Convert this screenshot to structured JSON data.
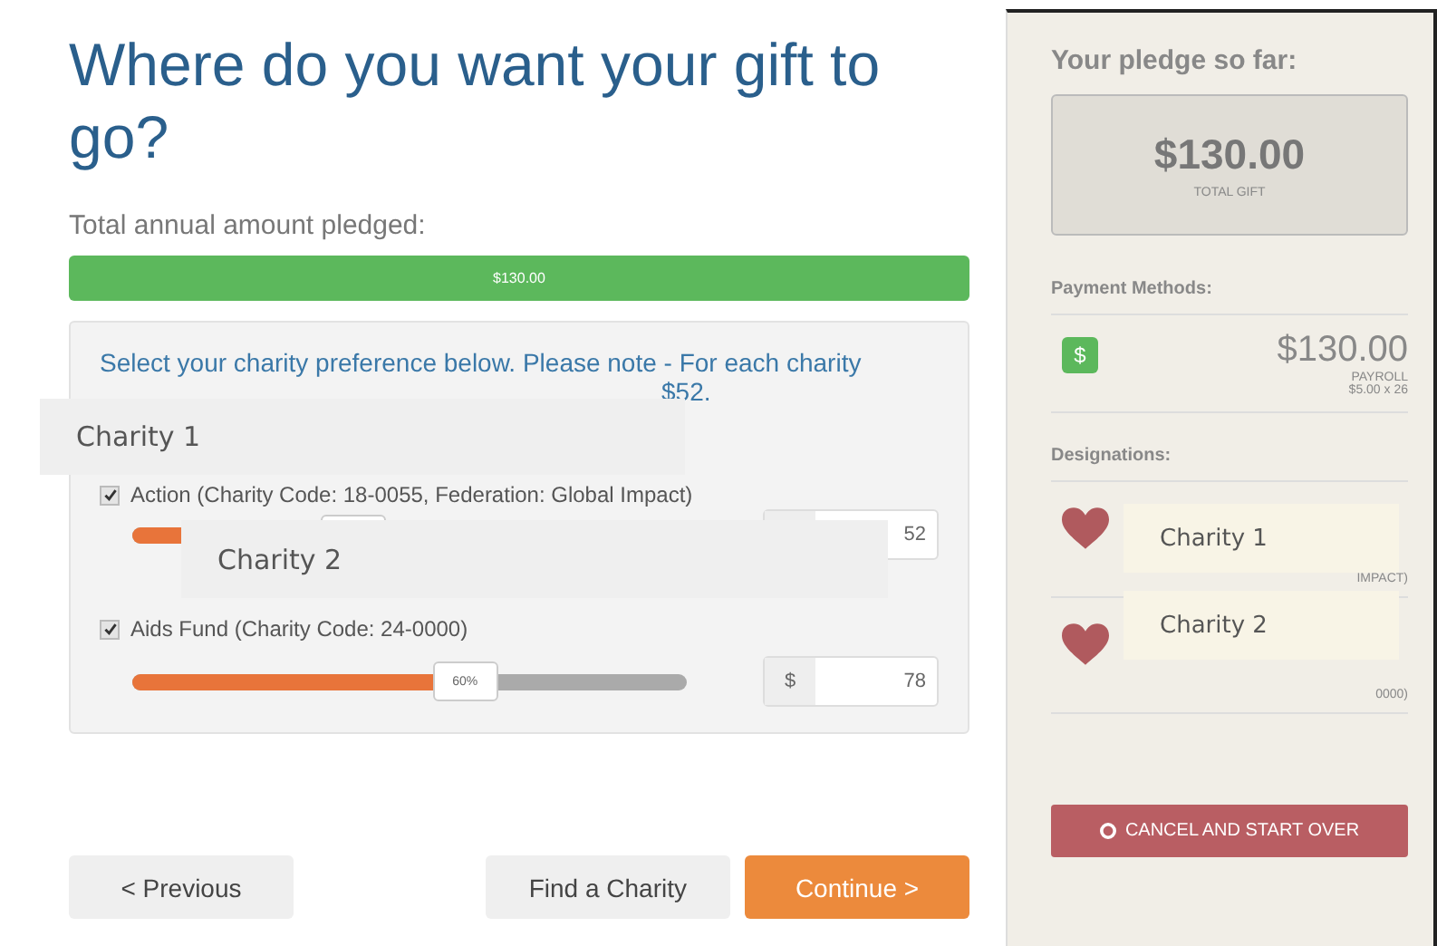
{
  "main": {
    "title": "Where do you want your gift to go?",
    "total_label": "Total annual amount pledged:",
    "total_bar": {
      "text": "$130.00",
      "level": 1
    },
    "panel": {
      "intro": "Select your charity preference below. Please note - For each charity",
      "intro_tail": "$52.",
      "charities": [
        {
          "name": "Action (Charity Code: 18-0055, Federation: Global Impact)",
          "checked": true,
          "level": 0.4,
          "amount": "52"
        },
        {
          "name": "Aids Fund (Charity Code: 24-0000)",
          "checked": true,
          "level": 0.6,
          "percent": "60%",
          "currency": "$",
          "amount": "78"
        }
      ]
    },
    "buttons": {
      "previous": "< Previous",
      "find": "Find a Charity",
      "continue": "Continue >"
    }
  },
  "sidebar": {
    "title": "Your pledge so far:",
    "total": {
      "amount": "$130.00",
      "label": "TOTAL GIFT"
    },
    "payment_methods": {
      "label": "Payment Methods:",
      "icon": "$",
      "amount": "$130.00",
      "type": "PAYROLL",
      "detail": "$5.00 x 26"
    },
    "designations": {
      "label": "Designations:",
      "items": [
        {
          "fragment": "IMPACT)"
        },
        {
          "fragment": "0000)"
        }
      ]
    },
    "cancel": "CANCEL AND START OVER"
  },
  "overlay_labels": [
    "Charity 1",
    "Charity 2",
    "Charity 1",
    "Charity 2"
  ]
}
